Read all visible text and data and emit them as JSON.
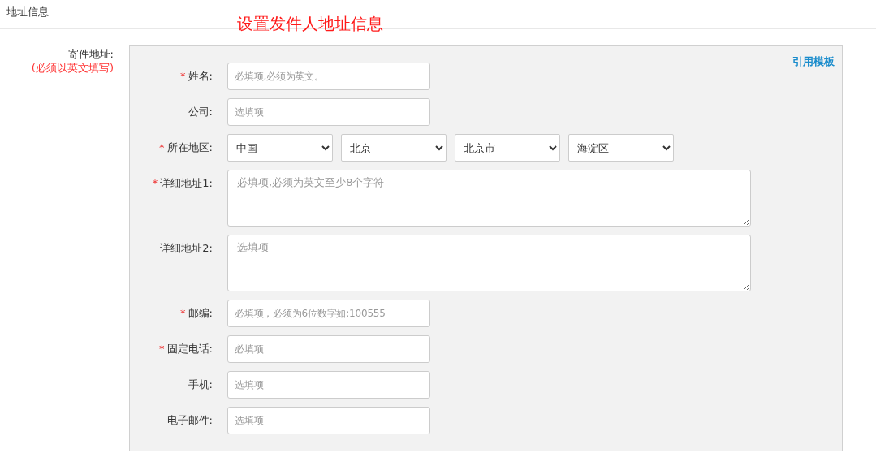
{
  "header": {
    "title": "地址信息"
  },
  "annotation": "设置发件人地址信息",
  "section": {
    "label": "寄件地址:",
    "note": "(必须以英文填写)"
  },
  "panel": {
    "template_link": "引用模板",
    "fields": [
      {
        "kind": "input",
        "required_mark": "*",
        "label": "姓名:",
        "placeholder": "必填项,必须为英文。"
      },
      {
        "kind": "input",
        "label": "公司:",
        "placeholder": "选填项"
      },
      {
        "kind": "selects",
        "required_mark": "*",
        "label": "所在地区:",
        "values": [
          "中国",
          "北京",
          "北京市",
          "海淀区"
        ]
      },
      {
        "kind": "textarea",
        "required_mark": "*",
        "label": "详细地址1:",
        "placeholder": "必填项,必须为英文至少8个字符"
      },
      {
        "kind": "textarea",
        "label": "详细地址2:",
        "placeholder": "选填项"
      },
      {
        "kind": "input",
        "required_mark": "*",
        "label": "邮编:",
        "placeholder": "必填项，必须为6位数字如:100555"
      },
      {
        "kind": "input",
        "required_mark": "*",
        "label": "固定电话:",
        "placeholder": "必填项"
      },
      {
        "kind": "input",
        "label": "手机:",
        "placeholder": "选填项"
      },
      {
        "kind": "input",
        "label": "电子邮件:",
        "placeholder": "选填项"
      }
    ]
  }
}
